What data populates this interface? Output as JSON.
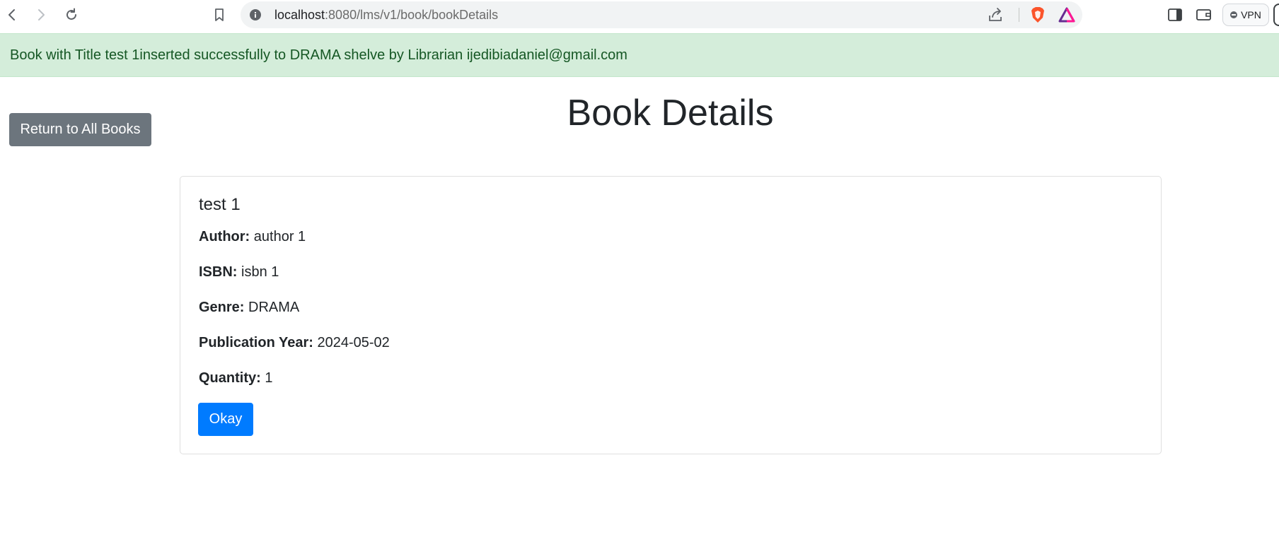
{
  "browser": {
    "url_host": "localhost",
    "url_rest": ":8080/lms/v1/book/bookDetails",
    "vpn_label": "VPN",
    "icons": [
      "back-icon",
      "forward-icon",
      "reload-icon",
      "bookmark-icon",
      "site-info-icon",
      "share-icon",
      "brave-shield-icon",
      "brave-rewards-icon",
      "sidebar-icon",
      "wallet-icon"
    ]
  },
  "alert": {
    "message": "Book with Title test 1inserted successfully to DRAMA shelve by Librarian ijedibiadaniel@gmail.com",
    "color": "#155724",
    "background": "#d4edda"
  },
  "nav": {
    "return_label": "Return to All Books"
  },
  "page": {
    "title": "Book Details"
  },
  "book": {
    "title": "test 1",
    "author_label": "Author:",
    "author": "author 1",
    "isbn_label": "ISBN:",
    "isbn": "isbn 1",
    "genre_label": "Genre:",
    "genre": "DRAMA",
    "year_label": "Publication Year:",
    "year": "2024-05-02",
    "quantity_label": "Quantity:",
    "quantity": "1"
  },
  "actions": {
    "okay_label": "Okay"
  },
  "colors": {
    "primary": "#007bff",
    "secondary": "#6c757d"
  }
}
